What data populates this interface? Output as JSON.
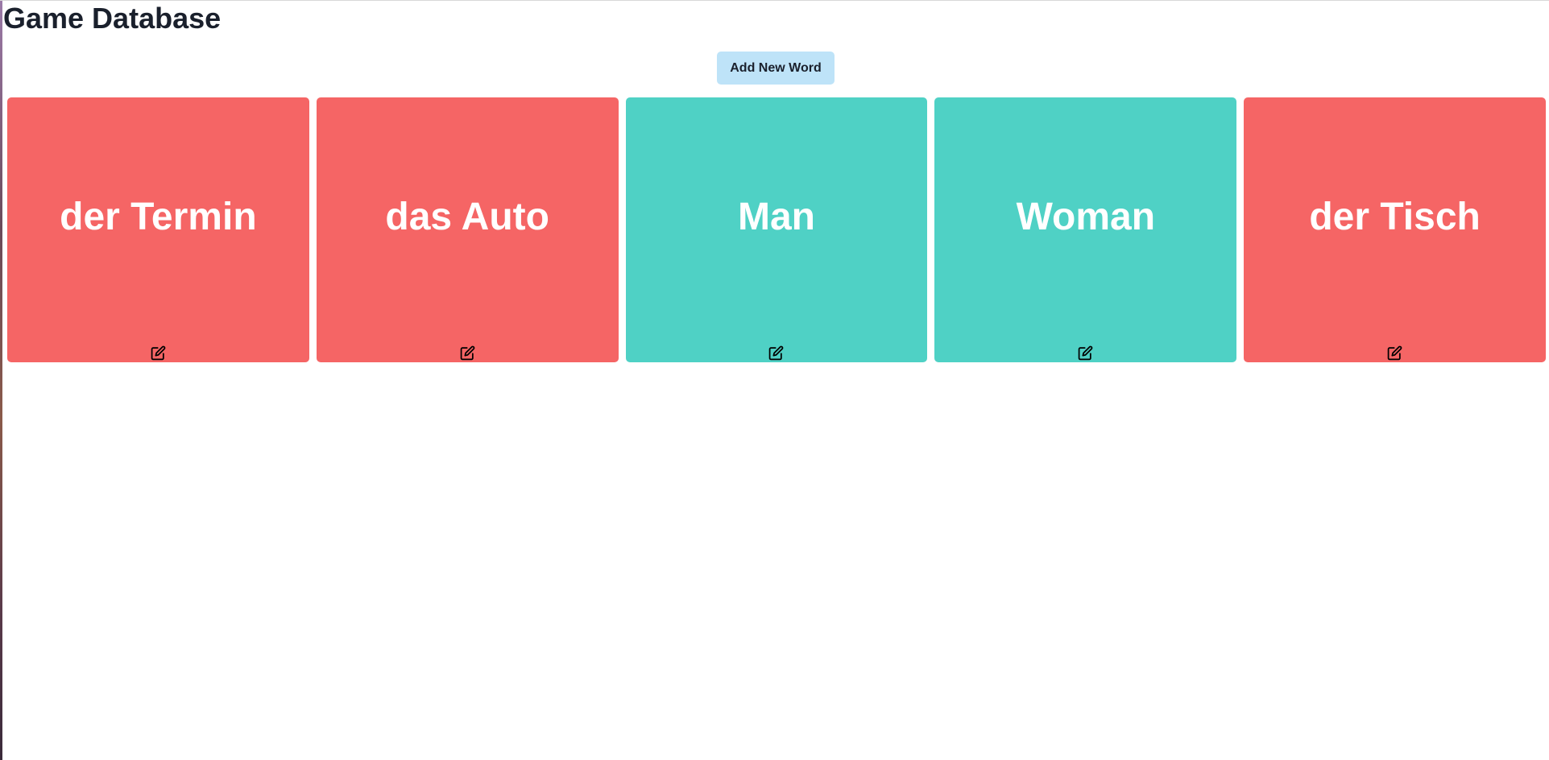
{
  "page": {
    "title": "Game Database",
    "add_button_label": "Add New Word"
  },
  "colors": {
    "card_red": "#f56565",
    "card_teal": "#4fd1c5",
    "button_bg": "#bee3f8"
  },
  "cards": [
    {
      "word": "der Termin",
      "color": "#f56565",
      "icon": "edit-icon"
    },
    {
      "word": "das Auto",
      "color": "#f56565",
      "icon": "edit-icon"
    },
    {
      "word": "Man",
      "color": "#4fd1c5",
      "icon": "edit-icon"
    },
    {
      "word": "Woman",
      "color": "#4fd1c5",
      "icon": "edit-icon"
    },
    {
      "word": "der Tisch",
      "color": "#f56565",
      "icon": "edit-icon"
    }
  ]
}
